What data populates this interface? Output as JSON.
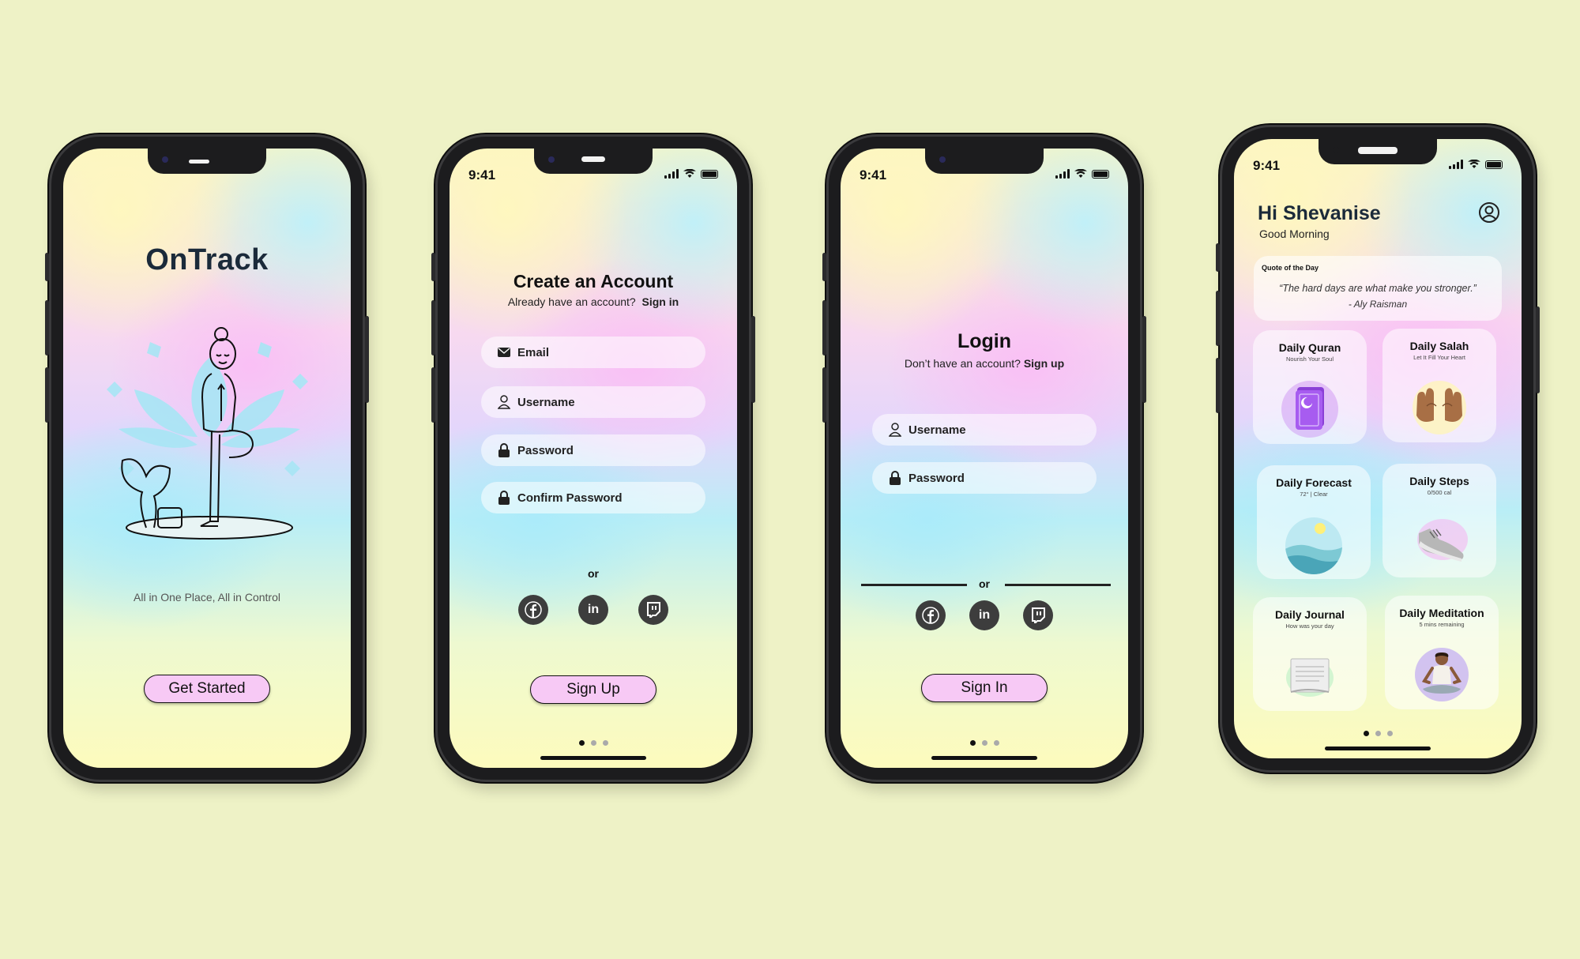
{
  "screen1": {
    "brand": "OnTrack",
    "tagline": "All in One Place, All in Control",
    "cta": "Get Started"
  },
  "screen2": {
    "time": "9:41",
    "title": "Create an Account",
    "prompt": "Already have an account?",
    "prompt_link": "Sign in",
    "fields": [
      {
        "label": "Email",
        "icon": "envelope-icon"
      },
      {
        "label": "Username",
        "icon": "user-icon"
      },
      {
        "label": "Password",
        "icon": "lock-icon"
      },
      {
        "label": "Confirm Password",
        "icon": "lock-icon"
      }
    ],
    "or": "or",
    "cta": "Sign Up"
  },
  "screen3": {
    "time": "9:41",
    "title": "Login",
    "prompt": "Don’t have an account?",
    "prompt_link": "Sign up",
    "fields": [
      {
        "label": "Username",
        "icon": "user-icon"
      },
      {
        "label": "Password",
        "icon": "lock-icon"
      }
    ],
    "or": "or",
    "cta": "Sign In"
  },
  "screen4": {
    "time": "9:41",
    "greeting": "Hi Shevanise",
    "subgreeting": "Good Morning",
    "quote_heading": "Quote of the Day",
    "quote_text": "“The hard days are what make you stronger.”",
    "quote_author": "- Aly Raisman",
    "tiles": [
      {
        "title": "Daily Quran",
        "subtitle": "Nourish Your Soul",
        "icon": "quran-book-icon"
      },
      {
        "title": "Daily Salah",
        "subtitle": "Let It Fill Your Heart",
        "icon": "praying-hands-icon"
      },
      {
        "title": "Daily Forecast",
        "subtitle": "72° | Clear",
        "icon": "weather-landscape-icon"
      },
      {
        "title": "Daily Steps",
        "subtitle": "0/500 cal",
        "icon": "sneaker-icon"
      },
      {
        "title": "Daily Journal",
        "subtitle": "How was your day",
        "icon": "journal-icon"
      },
      {
        "title": "Daily Meditation",
        "subtitle": "5 mins remaining",
        "icon": "meditation-icon"
      }
    ]
  },
  "social": [
    "facebook-icon",
    "linkedin-icon",
    "twitch-icon"
  ],
  "colors": {
    "background": "#eef2c6",
    "button": "#f7c9f5",
    "phone": "#1c1c1e"
  }
}
